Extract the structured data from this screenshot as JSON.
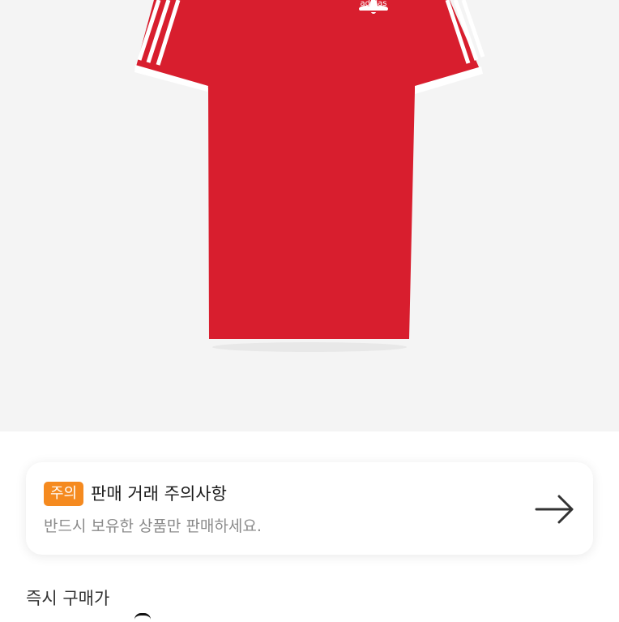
{
  "product": {
    "image_alt": "red adidas t-shirt with white three stripes",
    "brand_logo_text": "adidas",
    "colors": {
      "shirt": "#d81e2e",
      "trim": "#ffffff",
      "background": "#f4f4f4"
    }
  },
  "notice": {
    "badge": "주의",
    "title": "판매 거래 주의사항",
    "description": "반드시 보유한 상품만 판매하세요.",
    "arrow_icon": "arrow-right-icon",
    "badge_color": "#f58a1f"
  },
  "price": {
    "label": "즉시 구매가"
  }
}
